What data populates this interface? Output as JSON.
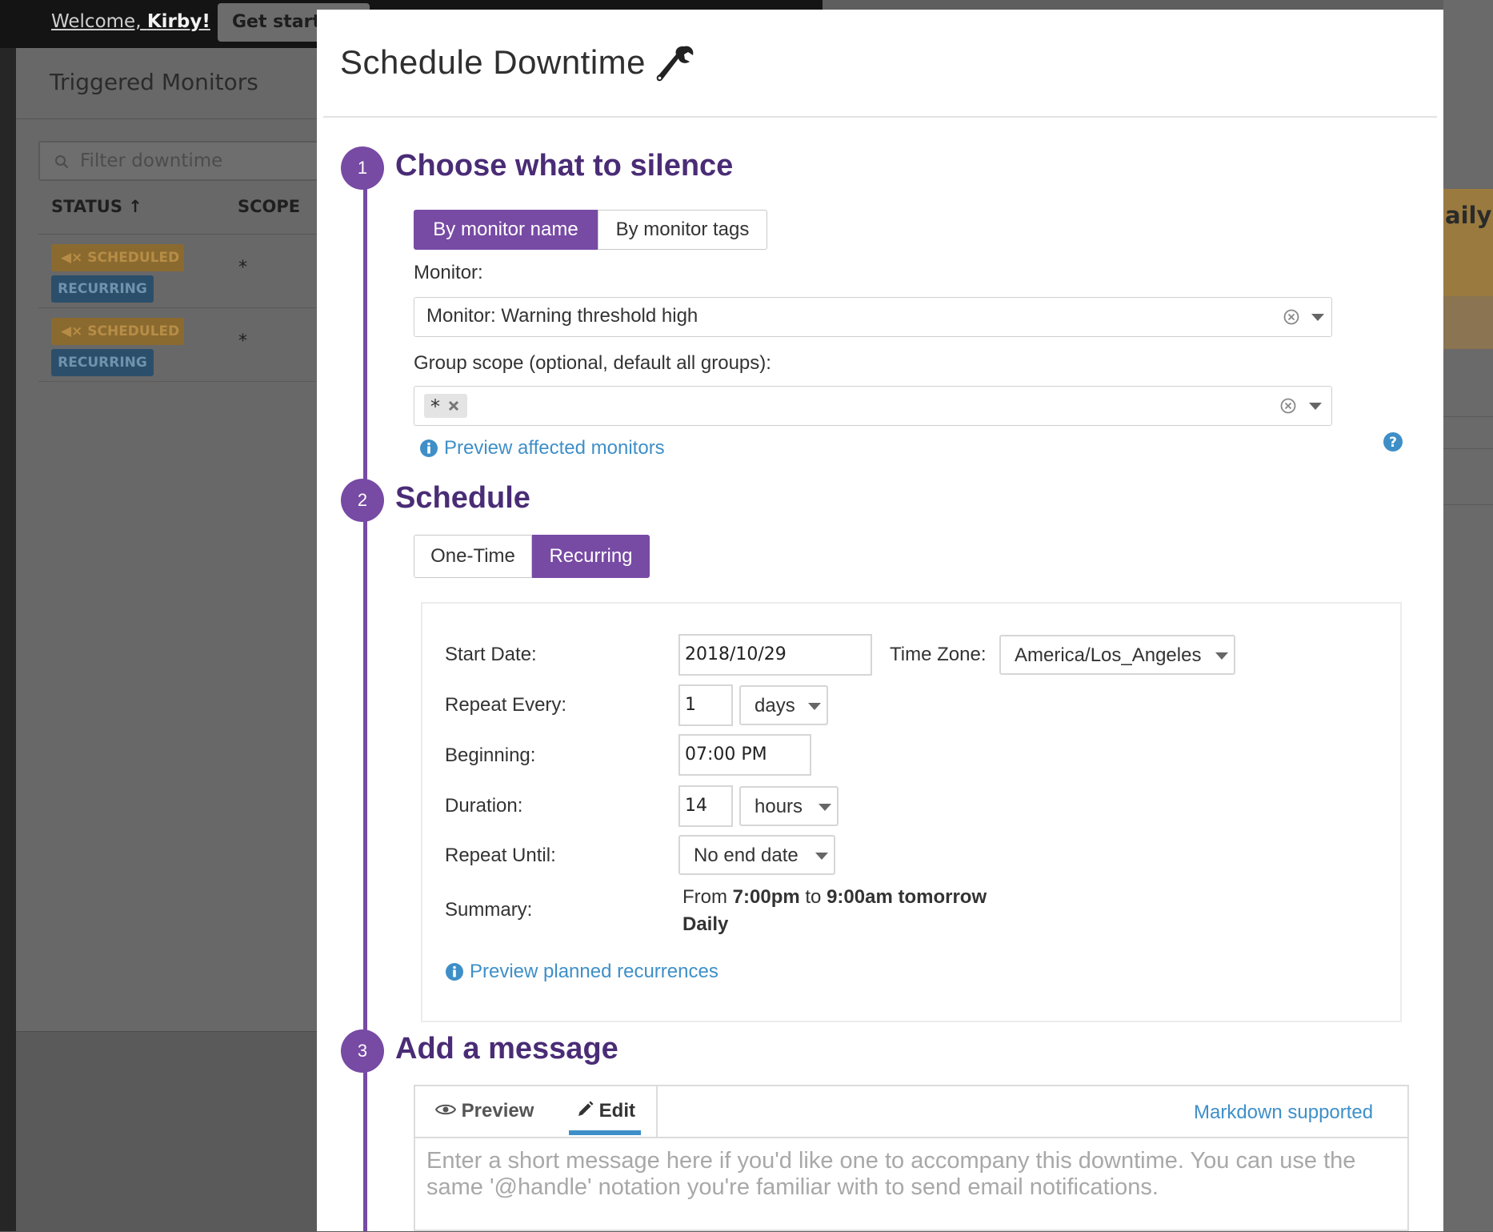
{
  "background": {
    "welcome_prefix": "Welcome, ",
    "welcome_name": "Kirby!",
    "get_started": "Get started",
    "page_title": "Triggered Monitors",
    "filter_placeholder": "Filter downtime",
    "col_status": "STATUS",
    "col_status_sort": "↑",
    "col_scope": "SCOPE",
    "rows": [
      {
        "status": "SCHEDULED",
        "type": "RECURRING",
        "scope": "*"
      },
      {
        "status": "SCHEDULED",
        "type": "RECURRING",
        "scope": "*"
      }
    ],
    "right_partial": "aily"
  },
  "modal": {
    "title": "Schedule Downtime",
    "title_icon": "wrench-icon",
    "steps": [
      {
        "number": "1",
        "title": "Choose what to silence"
      },
      {
        "number": "2",
        "title": "Schedule"
      },
      {
        "number": "3",
        "title": "Add a message"
      }
    ],
    "silence": {
      "by_name": "By monitor name",
      "by_tags": "By monitor tags",
      "active": "by_name",
      "monitor_label": "Monitor:",
      "monitor_value": "Monitor: Warning threshold high",
      "group_label": "Group scope (optional, default all groups):",
      "group_tag": "*",
      "preview_link": "Preview affected monitors",
      "help_icon": "question-circle-icon"
    },
    "schedule": {
      "one_time": "One-Time",
      "recurring": "Recurring",
      "active": "recurring",
      "start_date_label": "Start Date:",
      "start_date": "2018/10/29",
      "timezone_label": "Time Zone:",
      "timezone": "America/Los_Angeles",
      "repeat_every_label": "Repeat Every:",
      "repeat_every": "1",
      "repeat_unit": "days",
      "beginning_label": "Beginning:",
      "beginning": "07:00 PM",
      "duration_label": "Duration:",
      "duration": "14",
      "duration_unit": "hours",
      "repeat_until_label": "Repeat Until:",
      "repeat_until": "No end date",
      "summary_label": "Summary:",
      "summary_from": "From ",
      "summary_start": "7:00pm",
      "summary_to": " to ",
      "summary_end": "9:00am tomorrow",
      "summary_freq": "Daily",
      "preview_recurrences": "Preview planned recurrences"
    },
    "message": {
      "tab_preview": "Preview",
      "tab_edit": "Edit",
      "active_tab": "edit",
      "markdown": "Markdown supported",
      "placeholder": "Enter a short message here if you'd like one to accompany this downtime. You can use the same '@handle' notation you're familiar with to send email notifications."
    }
  },
  "colors": {
    "accent_purple": "#774aa4",
    "step_title": "#4a2c76",
    "link_blue": "#3e8fc8",
    "scheduled_badge": "#8b6a30",
    "recurring_badge": "#2b4f6b"
  }
}
